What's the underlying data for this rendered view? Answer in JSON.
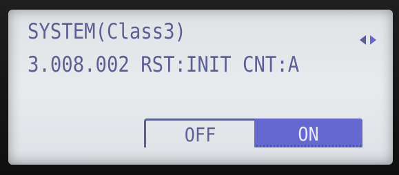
{
  "display": {
    "line1": "SYSTEM(Class3)",
    "line2": "3.008.002 RST:INIT CNT:A"
  },
  "indicator": {
    "icon": "left-right-arrows-icon"
  },
  "options": {
    "off_label": "OFF",
    "on_label": "ON",
    "selected": "ON"
  },
  "colors": {
    "lcd_text": "#5c5f95",
    "selected_background": "#6468cf",
    "screen_background": "#e3e6e9"
  }
}
